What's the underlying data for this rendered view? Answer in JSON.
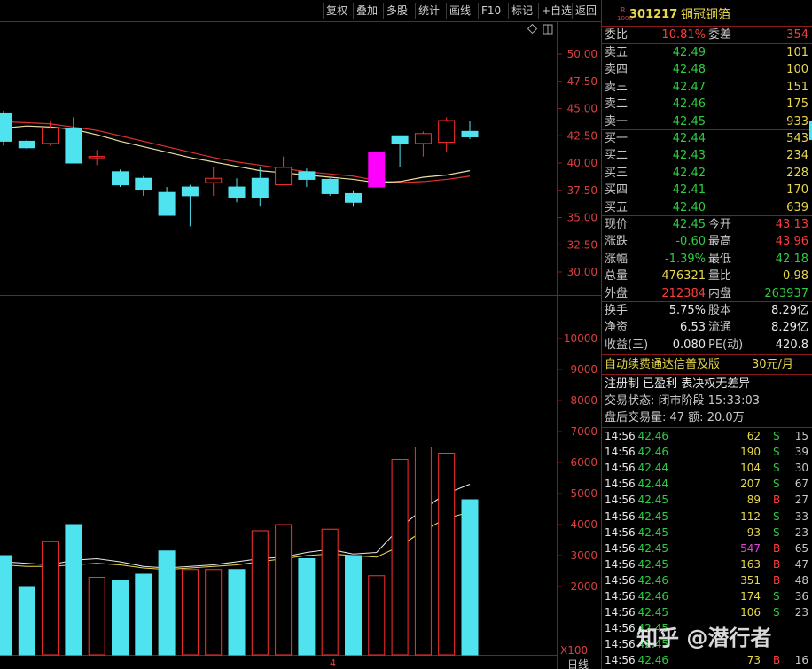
{
  "toolbar": {
    "buttons": [
      "复权",
      "叠加",
      "多股",
      "统计",
      "画线",
      "F10",
      "标记",
      "+自选",
      "返回"
    ]
  },
  "chart": {
    "price_axis": [
      "50.00",
      "47.50",
      "45.00",
      "42.50",
      "40.00",
      "37.50",
      "35.00",
      "32.50",
      "30.00"
    ],
    "volume_axis": [
      "10000",
      "9000",
      "8000",
      "7000",
      "6000",
      "5000",
      "4000",
      "3000",
      "2000"
    ],
    "volume_unit": "X100",
    "period_label": "日线",
    "date_tick": "4"
  },
  "chart_data": [
    {
      "type": "candlestick",
      "x": [
        1,
        2,
        3,
        4,
        5,
        6,
        7,
        8,
        9,
        10,
        11,
        12,
        13,
        14,
        15,
        16,
        17,
        18,
        19,
        20,
        21
      ],
      "open": [
        44.6,
        42.0,
        41.8,
        43.2,
        40.6,
        39.2,
        38.6,
        37.3,
        37.8,
        38.2,
        37.8,
        38.6,
        38.0,
        39.2,
        38.5,
        37.2,
        37.8,
        42.5,
        41.8,
        41.9,
        42.9
      ],
      "close": [
        42.0,
        41.4,
        43.2,
        40.0,
        40.6,
        38.0,
        37.6,
        35.2,
        37.0,
        38.6,
        36.8,
        36.8,
        39.6,
        38.5,
        37.2,
        36.4,
        41.0,
        41.8,
        42.7,
        43.9,
        42.4
      ],
      "high": [
        44.8,
        42.2,
        43.8,
        44.2,
        41.2,
        39.4,
        38.8,
        37.8,
        38.0,
        39.6,
        38.6,
        39.6,
        40.6,
        39.5,
        38.6,
        37.5,
        41.0,
        42.0,
        42.9,
        44.2,
        43.9
      ],
      "low": [
        41.6,
        41.2,
        41.6,
        40.0,
        39.8,
        37.8,
        37.0,
        35.2,
        34.2,
        37.0,
        36.4,
        36.0,
        38.0,
        37.8,
        37.0,
        36.0,
        38.0,
        39.6,
        40.6,
        41.0,
        42.2
      ],
      "ma_short": [
        43.2,
        43.4,
        43.3,
        43.1,
        42.6,
        42.0,
        41.5,
        41.0,
        40.5,
        40.1,
        39.7,
        39.3,
        39.1,
        38.9,
        38.7,
        38.5,
        38.2,
        38.3,
        38.7,
        38.9,
        39.3
      ],
      "ma_long": [
        43.8,
        43.7,
        43.6,
        43.3,
        43.0,
        42.5,
        42.0,
        41.5,
        41.0,
        40.5,
        40.1,
        39.8,
        39.5,
        39.2,
        39.0,
        38.8,
        38.4,
        38.2,
        38.3,
        38.5,
        38.8
      ],
      "ylim": [
        28.5,
        52.0
      ]
    },
    {
      "type": "bar",
      "x": [
        1,
        2,
        3,
        4,
        5,
        6,
        7,
        8,
        9,
        10,
        11,
        12,
        13,
        14,
        15,
        16,
        17,
        18,
        19,
        20,
        21
      ],
      "values": [
        3000,
        2000,
        3450,
        4000,
        2300,
        2200,
        2400,
        3150,
        2550,
        2550,
        2550,
        3800,
        4000,
        2900,
        3850,
        3000,
        2350,
        6100,
        6500,
        6300,
        4800
      ],
      "direction": [
        "down",
        "down",
        "up",
        "down",
        "up",
        "down",
        "down",
        "down",
        "up",
        "up",
        "down",
        "up",
        "up",
        "down",
        "up",
        "down",
        "up",
        "up",
        "up",
        "up",
        "down"
      ],
      "ma_short": [
        2800,
        2750,
        2700,
        2850,
        2900,
        2800,
        2650,
        2600,
        2650,
        2700,
        2800,
        2900,
        2950,
        3100,
        3200,
        3050,
        3100,
        3900,
        4500,
        5000,
        5300
      ],
      "ma_long": [
        2700,
        2650,
        2650,
        2700,
        2750,
        2700,
        2600,
        2550,
        2600,
        2650,
        2700,
        2800,
        2900,
        3000,
        3050,
        3000,
        2950,
        3300,
        3800,
        4200,
        4400
      ],
      "ylim": [
        0,
        10600
      ]
    }
  ],
  "panel": {
    "stock_code": "301217",
    "stock_name": "铜冠铜箔",
    "stock_badge_top": "R",
    "stock_badge_bottom": "1000",
    "weibi_label": "委比",
    "weibi_value": "10.81%",
    "weicha_label": "委差",
    "weicha_value": "354",
    "asks": [
      {
        "label": "卖五",
        "price": "42.49",
        "vol": "101"
      },
      {
        "label": "卖四",
        "price": "42.48",
        "vol": "100"
      },
      {
        "label": "卖三",
        "price": "42.47",
        "vol": "151"
      },
      {
        "label": "卖二",
        "price": "42.46",
        "vol": "175"
      },
      {
        "label": "卖一",
        "price": "42.45",
        "vol": "933"
      }
    ],
    "bids": [
      {
        "label": "买一",
        "price": "42.44",
        "vol": "543"
      },
      {
        "label": "买二",
        "price": "42.43",
        "vol": "234"
      },
      {
        "label": "买三",
        "price": "42.42",
        "vol": "228"
      },
      {
        "label": "买四",
        "price": "42.41",
        "vol": "170"
      },
      {
        "label": "买五",
        "price": "42.40",
        "vol": "639"
      }
    ],
    "quote": [
      {
        "l1": "现价",
        "v1": "42.45",
        "l2": "今开",
        "v2": "43.13"
      },
      {
        "l1": "涨跌",
        "v1": "-0.60",
        "l2": "最高",
        "v2": "43.96"
      },
      {
        "l1": "涨幅",
        "v1": "-1.39%",
        "l2": "最低",
        "v2": "42.18"
      },
      {
        "l1": "总量",
        "v1": "476321",
        "l2": "量比",
        "v2": "0.98"
      },
      {
        "l1": "外盘",
        "v1": "212384",
        "l2": "内盘",
        "v2": "263937"
      }
    ],
    "fund": [
      {
        "l1": "换手",
        "v1": "5.75%",
        "l2": "股本",
        "v2": "8.29亿"
      },
      {
        "l1": "净资",
        "v1": "6.53",
        "l2": "流通",
        "v2": "8.29亿"
      },
      {
        "l1": "收益(三)",
        "v1": "0.080",
        "l2": "PE(动)",
        "v2": "420.8"
      }
    ],
    "promo_text": "自动续费通达信普及版",
    "promo_price": "30元/月",
    "notice": "注册制 已盈利 表决权无差异",
    "trade_status": "交易状态: 闭市阶段 15:33:03",
    "after_hours": "盘后交易量: 47  额: 20.0万",
    "ticks": [
      {
        "t": "14:56",
        "p": "42.46",
        "v": "62",
        "d": "S",
        "n": "15"
      },
      {
        "t": "14:56",
        "p": "42.46",
        "v": "190",
        "d": "S",
        "n": "39"
      },
      {
        "t": "14:56",
        "p": "42.44",
        "v": "104",
        "d": "S",
        "n": "30"
      },
      {
        "t": "14:56",
        "p": "42.44",
        "v": "207",
        "d": "S",
        "n": "67"
      },
      {
        "t": "14:56",
        "p": "42.45",
        "v": "89",
        "d": "B",
        "n": "27"
      },
      {
        "t": "14:56",
        "p": "42.45",
        "v": "112",
        "d": "S",
        "n": "33"
      },
      {
        "t": "14:56",
        "p": "42.45",
        "v": "93",
        "d": "S",
        "n": "23"
      },
      {
        "t": "14:56",
        "p": "42.45",
        "v": "547",
        "d": "B",
        "n": "65"
      },
      {
        "t": "14:56",
        "p": "42.45",
        "v": "163",
        "d": "B",
        "n": "47"
      },
      {
        "t": "14:56",
        "p": "42.46",
        "v": "351",
        "d": "B",
        "n": "48"
      },
      {
        "t": "14:56",
        "p": "42.46",
        "v": "174",
        "d": "S",
        "n": "36"
      },
      {
        "t": "14:56",
        "p": "42.45",
        "v": "106",
        "d": "S",
        "n": "23"
      },
      {
        "t": "14:56",
        "p": "42.45",
        "v": "",
        "d": "",
        "n": ""
      },
      {
        "t": "14:56",
        "p": "42.45",
        "v": "",
        "d": "",
        "n": ""
      },
      {
        "t": "14:56",
        "p": "42.46",
        "v": "73",
        "d": "B",
        "n": "16"
      }
    ]
  },
  "watermark": "知乎 @潜行者"
}
